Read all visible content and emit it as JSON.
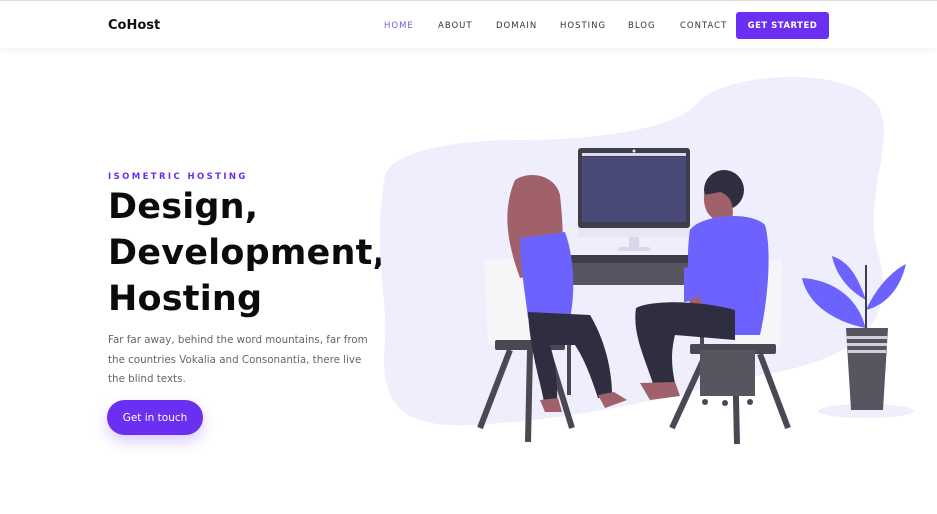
{
  "brand": {
    "name": "CoHost"
  },
  "nav": {
    "items": [
      {
        "label": "HOME",
        "active": true
      },
      {
        "label": "ABOUT",
        "active": false
      },
      {
        "label": "DOMAIN",
        "active": false
      },
      {
        "label": "HOSTING",
        "active": false
      },
      {
        "label": "BLOG",
        "active": false
      },
      {
        "label": "CONTACT",
        "active": false
      }
    ],
    "cta_label": "GET STARTED"
  },
  "hero": {
    "eyebrow": "ISOMETRIC HOSTING",
    "headline": [
      "Design,",
      "Development,",
      "Hosting"
    ],
    "description": "Far far away, behind the word mountains, far from the countries Vokalia and Consonantia, there live the blind texts.",
    "button_label": "Get in touch"
  },
  "colors": {
    "accent": "#6a2ff0",
    "nav_active": "#7a5ae0",
    "blob": "#efeefd",
    "figure_purple": "#6c63ff",
    "dark": "#4a4852"
  },
  "icons": [
    "computer-illustration",
    "woman-figure",
    "man-figure",
    "chair-icon",
    "plant-icon"
  ]
}
